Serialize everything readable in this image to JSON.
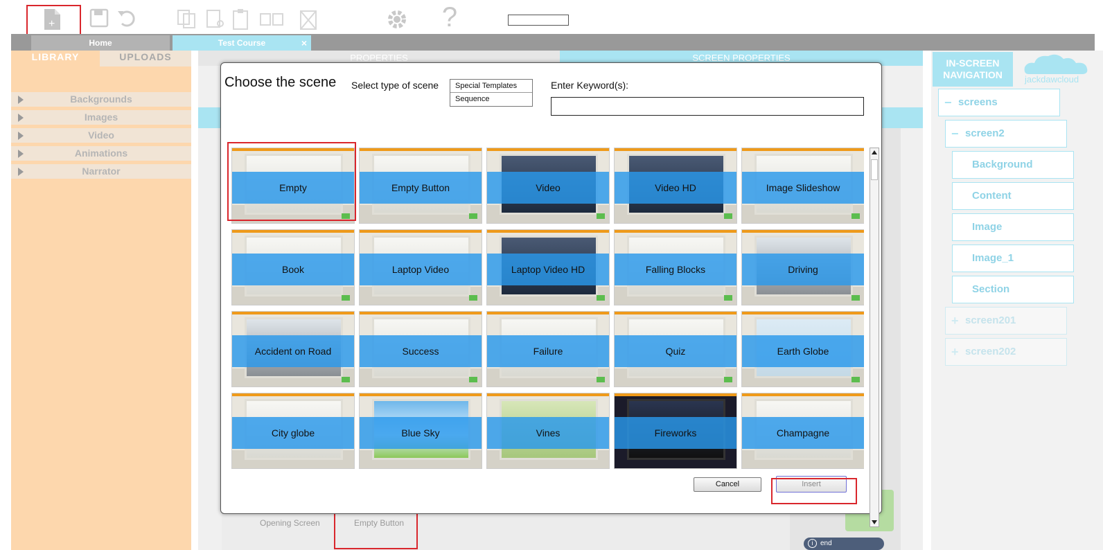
{
  "toolbar": {
    "icons": [
      "new-page-icon",
      "save-icon",
      "undo-icon",
      "copy-icon",
      "cut-icon",
      "paste-icon",
      "duplicate-icon",
      "delete-icon",
      "gear-icon",
      "help-icon"
    ],
    "new_glyph": "+",
    "help_glyph": "?",
    "search_value": ""
  },
  "tabs": {
    "home": "Home",
    "course": "Test Course",
    "close_glyph": "×"
  },
  "library": {
    "tab_library": "LIBRARY",
    "tab_uploads": "UPLOADS",
    "items": [
      "Backgrounds",
      "Images",
      "Video",
      "Animations",
      "Narrator"
    ]
  },
  "middle": {
    "properties": "PROPERTIES",
    "screen_properties": "SCREEN PROPERTIES"
  },
  "nav": {
    "title": "IN-SCREEN NAVIGATION",
    "brand": "jackdawcloud",
    "nodes": [
      {
        "label": "screens",
        "icon": "−"
      },
      {
        "label": "screen2",
        "icon": "−"
      },
      {
        "label": "Background",
        "icon": ""
      },
      {
        "label": "Content",
        "icon": ""
      },
      {
        "label": "Image",
        "icon": ""
      },
      {
        "label": "Image_1",
        "icon": ""
      },
      {
        "label": "Section",
        "icon": ""
      },
      {
        "label": "screen201",
        "icon": "+"
      },
      {
        "label": "screen202",
        "icon": "+"
      }
    ]
  },
  "modal": {
    "title": "Choose the scene",
    "type_label": "Select type of scene",
    "type_options": [
      "Special Templates",
      "Sequence"
    ],
    "keyword_label": "Enter Keyword(s):",
    "keyword_value": "",
    "cancel": "Cancel",
    "insert": "Insert",
    "scenes": [
      "Empty",
      "Empty Button",
      "Video",
      "Video HD",
      "Image Slideshow",
      "Book",
      "Laptop Video",
      "Laptop Video HD",
      "Falling Blocks",
      "Driving",
      "Accident on Road",
      "Success",
      "Failure",
      "Quiz",
      "Earth Globe",
      "City globe",
      "Blue Sky",
      "Vines",
      "Fireworks",
      "Champagne"
    ]
  },
  "filmstrip": {
    "items": [
      "Opening Screen",
      "Empty Button"
    ],
    "end_label": "end"
  },
  "colors": {
    "accent_blue": "#2999ec",
    "highlight_red": "#d9262c",
    "library_bg": "#fdd7ad",
    "tab_blue": "#a9e4f2"
  }
}
